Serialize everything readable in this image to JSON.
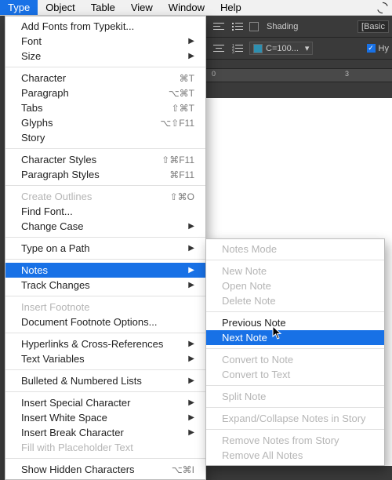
{
  "menubar": [
    "Type",
    "Object",
    "Table",
    "View",
    "Window",
    "Help"
  ],
  "toolbar": {
    "shading_label": "Shading",
    "basic_label": "[Basic",
    "color_swatch_label": "C=100...",
    "hyphen_label": "Hy"
  },
  "ruler_ticks": [
    "0",
    "3"
  ],
  "type_menu": [
    {
      "label": "Add Fonts from Typekit..."
    },
    {
      "label": "Font",
      "arrow": true
    },
    {
      "label": "Size",
      "arrow": true
    },
    {
      "sep": true
    },
    {
      "label": "Character",
      "shortcut": "⌘T"
    },
    {
      "label": "Paragraph",
      "shortcut": "⌥⌘T"
    },
    {
      "label": "Tabs",
      "shortcut": "⇧⌘T"
    },
    {
      "label": "Glyphs",
      "shortcut": "⌥⇧F11"
    },
    {
      "label": "Story"
    },
    {
      "sep": true
    },
    {
      "label": "Character Styles",
      "shortcut": "⇧⌘F11"
    },
    {
      "label": "Paragraph Styles",
      "shortcut": "⌘F11"
    },
    {
      "sep": true
    },
    {
      "label": "Create Outlines",
      "shortcut": "⇧⌘O",
      "disabled": true
    },
    {
      "label": "Find Font..."
    },
    {
      "label": "Change Case",
      "arrow": true
    },
    {
      "sep": true
    },
    {
      "label": "Type on a Path",
      "arrow": true
    },
    {
      "sep": true
    },
    {
      "label": "Notes",
      "arrow": true,
      "highlight": true
    },
    {
      "label": "Track Changes",
      "arrow": true
    },
    {
      "sep": true
    },
    {
      "label": "Insert Footnote",
      "disabled": true
    },
    {
      "label": "Document Footnote Options..."
    },
    {
      "sep": true
    },
    {
      "label": "Hyperlinks & Cross-References",
      "arrow": true
    },
    {
      "label": "Text Variables",
      "arrow": true
    },
    {
      "sep": true
    },
    {
      "label": "Bulleted & Numbered Lists",
      "arrow": true
    },
    {
      "sep": true
    },
    {
      "label": "Insert Special Character",
      "arrow": true
    },
    {
      "label": "Insert White Space",
      "arrow": true
    },
    {
      "label": "Insert Break Character",
      "arrow": true
    },
    {
      "label": "Fill with Placeholder Text",
      "disabled": true
    },
    {
      "sep": true
    },
    {
      "label": "Show Hidden Characters",
      "shortcut": "⌥⌘I"
    }
  ],
  "notes_submenu": [
    {
      "label": "Notes Mode",
      "disabled": true
    },
    {
      "sep": true
    },
    {
      "label": "New Note",
      "disabled": true
    },
    {
      "label": "Open Note",
      "disabled": true
    },
    {
      "label": "Delete Note",
      "disabled": true
    },
    {
      "sep": true
    },
    {
      "label": "Previous Note"
    },
    {
      "label": "Next Note",
      "highlight": true
    },
    {
      "sep": true
    },
    {
      "label": "Convert to Note",
      "disabled": true
    },
    {
      "label": "Convert to Text",
      "disabled": true
    },
    {
      "sep": true
    },
    {
      "label": "Split Note",
      "disabled": true
    },
    {
      "sep": true
    },
    {
      "label": "Expand/Collapse Notes in Story",
      "disabled": true
    },
    {
      "sep": true
    },
    {
      "label": "Remove Notes from Story",
      "disabled": true
    },
    {
      "label": "Remove All Notes",
      "disabled": true
    }
  ]
}
